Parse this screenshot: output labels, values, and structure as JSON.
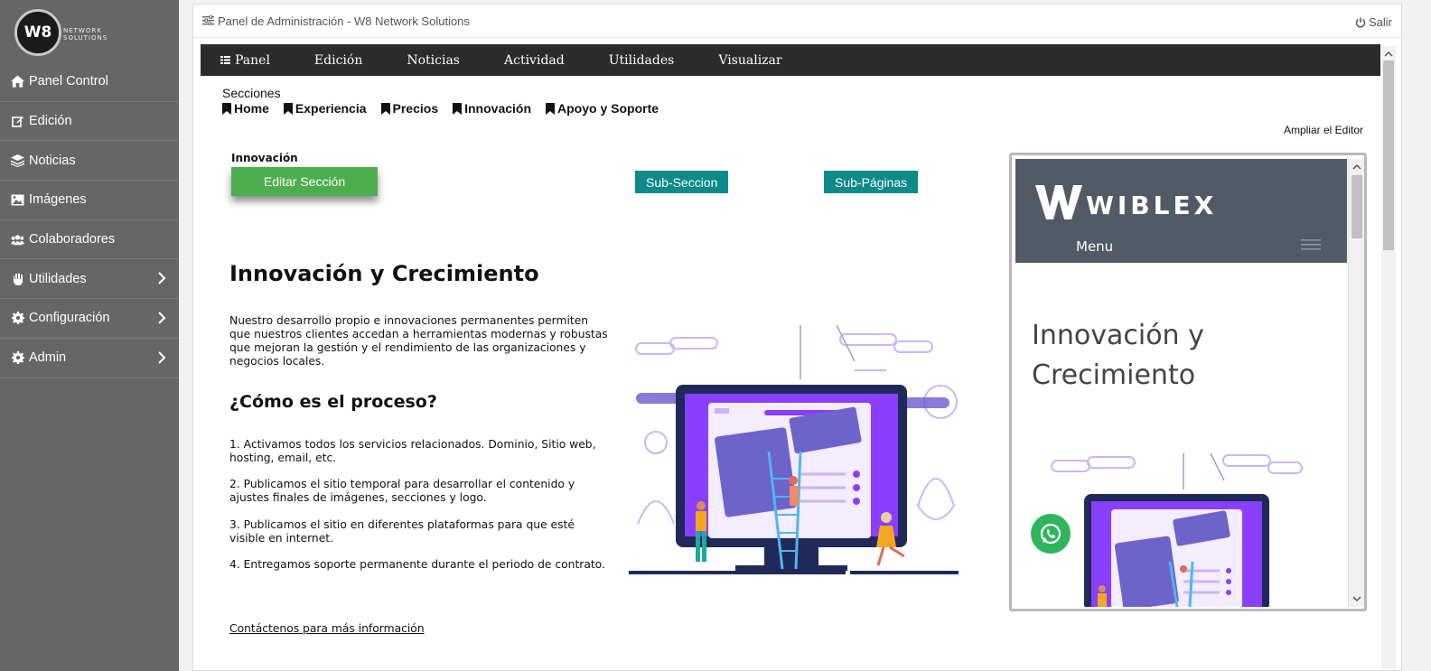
{
  "sidebar": {
    "logo_mark": "W8",
    "logo_text": [
      "NETWORK",
      "SOLUTIONS"
    ],
    "items": [
      {
        "label": "Panel Control",
        "icon": "home-icon"
      },
      {
        "label": "Edición",
        "icon": "edit-icon"
      },
      {
        "label": "Noticias",
        "icon": "layers-icon"
      },
      {
        "label": "Imágenes",
        "icon": "image-icon"
      },
      {
        "label": "Colaboradores",
        "icon": "users-icon"
      },
      {
        "label": "Utilidades",
        "icon": "hand-icon",
        "has_children": true
      },
      {
        "label": "Configuración",
        "icon": "gear-icon",
        "has_children": true
      },
      {
        "label": "Admin",
        "icon": "gear-icon",
        "has_children": true
      }
    ]
  },
  "topbar": {
    "title": "Panel de Administración - W8 Network Solutions",
    "logout_label": "Salir"
  },
  "menubar": {
    "items": [
      "Panel",
      "Edición",
      "Noticias",
      "Actividad",
      "Utilidades",
      "Visualizar"
    ]
  },
  "sections": {
    "label": "Secciones",
    "items": [
      "Home",
      "Experiencia",
      "Precios",
      "Innovación",
      "Apoyo y Soporte"
    ]
  },
  "editor": {
    "expand_label": "Ampliar el Editor",
    "current_section": "Innovación",
    "edit_button": "Editar Sección",
    "subsection_button": "Sub-Seccion",
    "subpages_button": "Sub-Páginas"
  },
  "content": {
    "heading": "Innovación y Crecimiento",
    "intro": "Nuestro desarrollo propio e innovaciones permanentes permiten que nuestros clientes accedan a herramientas modernas y robustas que mejoran la gestión y el rendimiento de las organizaciones y negocios locales.",
    "subheading": "¿Cómo es el proceso?",
    "steps": [
      "1. Activamos todos los servicios relacionados. Dominio, Sitio web, hosting, email, etc.",
      "2. Publicamos el sitio temporal para desarrollar el contenido y ajustes finales de imágenes, secciones y logo.",
      "3. Publicamos el sitio en diferentes plataformas para que esté visible en internet.",
      "4. Entregamos soporte permanente durante el periodo de contrato."
    ],
    "contact_link": "Contáctenos para más información"
  },
  "preview": {
    "brand": "WIBLEX",
    "menu_label": "Menu",
    "title": "Innovación y Crecimiento"
  },
  "colors": {
    "sidebar_bg": "#666666",
    "menubar_bg": "#2b2b2b",
    "edit_button": "#4cae4c",
    "teal_button": "#0e8a8a",
    "preview_header": "#525b65",
    "illustration_purple": "#7b3fe4"
  }
}
